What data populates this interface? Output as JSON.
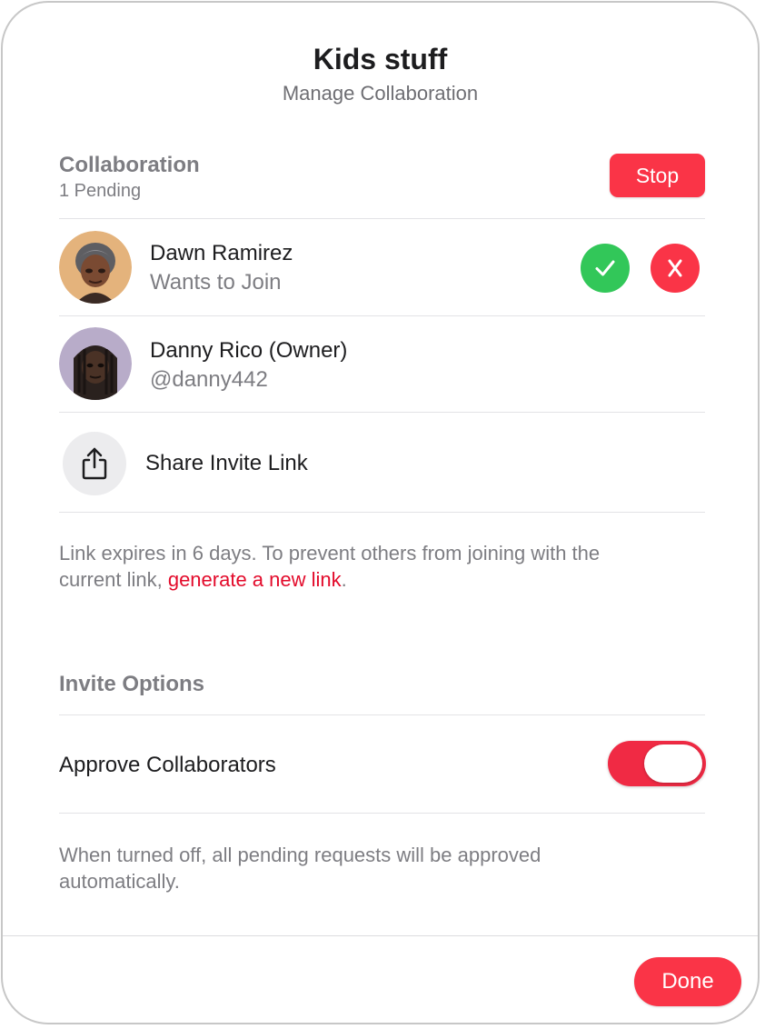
{
  "header": {
    "title": "Kids stuff",
    "subtitle": "Manage Collaboration"
  },
  "collaboration": {
    "heading": "Collaboration",
    "pending": "1 Pending",
    "stop_label": "Stop"
  },
  "people": [
    {
      "name": "Dawn Ramirez",
      "detail": "Wants to Join",
      "avatar_icon": "memoji-avatar-icon",
      "accept_icon": "checkmark-icon",
      "decline_icon": "x-icon"
    },
    {
      "name": "Danny Rico (Owner)",
      "detail": "@danny442",
      "avatar_icon": "memoji-avatar-icon"
    }
  ],
  "share": {
    "label": "Share Invite Link",
    "icon": "share-icon"
  },
  "link_note": {
    "line1": "Link expires in 6 days. To prevent others from joining with the",
    "line2_prefix": "current link, ",
    "link_text": "generate a new link",
    "line2_suffix": "."
  },
  "invite_options": {
    "heading": "Invite Options",
    "approve_label": "Approve Collaborators",
    "approve_on": true,
    "note_line1": "When turned off, all pending requests will be approved",
    "note_line2": "automatically."
  },
  "footer": {
    "done_label": "Done"
  },
  "colors": {
    "accent_red": "#fa3447",
    "accept_green": "#32c759",
    "link_red": "#e30b2b"
  }
}
